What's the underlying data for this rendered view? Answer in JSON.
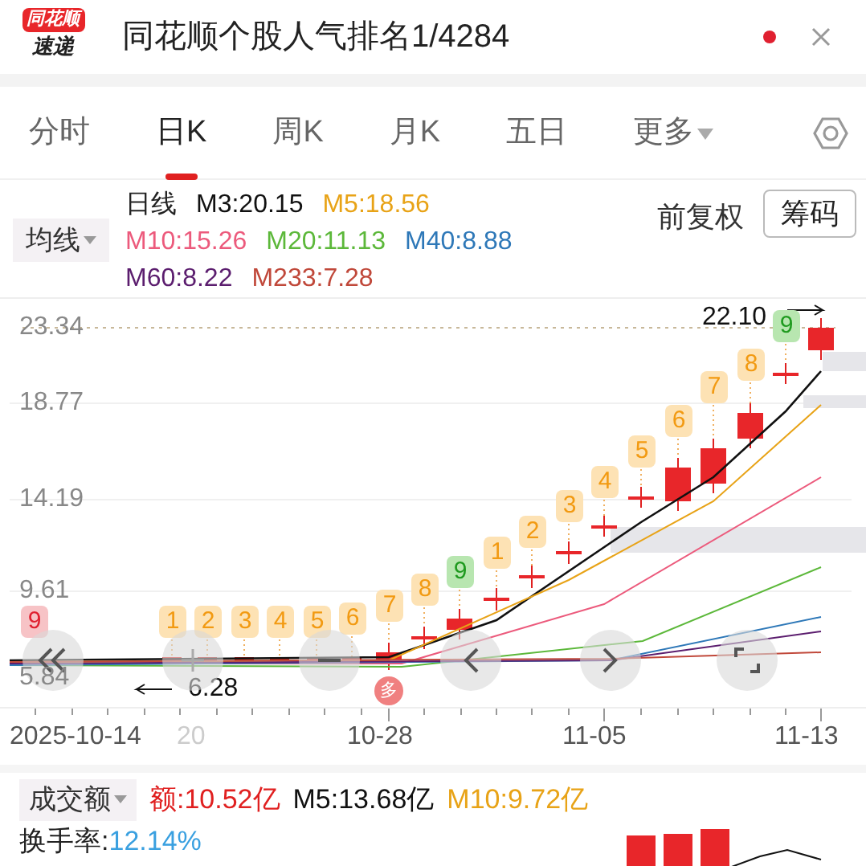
{
  "header": {
    "logo_top": "同花顺",
    "logo_bottom": "速递",
    "title": "同花顺个股人气排名1/4284"
  },
  "tabs": [
    {
      "label": "分时",
      "selected": false,
      "kind": "plain"
    },
    {
      "label": "日K",
      "selected": true,
      "kind": "plain"
    },
    {
      "label": "周K",
      "selected": false,
      "kind": "plain"
    },
    {
      "label": "月K",
      "selected": false,
      "kind": "plain"
    },
    {
      "label": "五日",
      "selected": false,
      "kind": "plain"
    },
    {
      "label": "更多",
      "selected": false,
      "kind": "dropdown"
    }
  ],
  "legend": {
    "selector": "均线",
    "rows": [
      [
        {
          "text": "日线",
          "color": "#222222"
        },
        {
          "text": "M3:20.15",
          "color": "#111111"
        },
        {
          "text": "M5:18.56",
          "color": "#e8a317"
        }
      ],
      [
        {
          "text": "M10:15.26",
          "color": "#ec5a7c"
        },
        {
          "text": "M20:11.13",
          "color": "#5cb83a"
        },
        {
          "text": "M40:8.88",
          "color": "#2e78b8"
        }
      ],
      [
        {
          "text": "M60:8.22",
          "color": "#5b1d6e"
        },
        {
          "text": "M233:7.28",
          "color": "#c0483a"
        }
      ]
    ],
    "adjust": "前复权",
    "chips_button": "筹码"
  },
  "chart": {
    "y_labels": [
      "23.34",
      "18.77",
      "14.19",
      "9.61",
      "5.84"
    ],
    "high_label": "22.10",
    "low_label": "6.28",
    "signal_marker": "多",
    "td_markers": [
      {
        "label": "9",
        "kind": "down"
      },
      {
        "label": "1",
        "kind": "count"
      },
      {
        "label": "2",
        "kind": "count"
      },
      {
        "label": "3",
        "kind": "count"
      },
      {
        "label": "4",
        "kind": "count"
      },
      {
        "label": "5",
        "kind": "count"
      },
      {
        "label": "6",
        "kind": "count"
      },
      {
        "label": "7",
        "kind": "count"
      },
      {
        "label": "8",
        "kind": "count"
      },
      {
        "label": "9",
        "kind": "up"
      },
      {
        "label": "1",
        "kind": "count"
      },
      {
        "label": "2",
        "kind": "count"
      },
      {
        "label": "3",
        "kind": "count"
      },
      {
        "label": "4",
        "kind": "count"
      },
      {
        "label": "5",
        "kind": "count"
      },
      {
        "label": "6",
        "kind": "count"
      },
      {
        "label": "7",
        "kind": "count"
      },
      {
        "label": "8",
        "kind": "count"
      },
      {
        "label": "9",
        "kind": "up"
      }
    ],
    "x_labels": [
      {
        "text": "2025-10-14",
        "kind": "main"
      },
      {
        "text": "20",
        "kind": "faded"
      },
      {
        "text": "10-28",
        "kind": "main"
      },
      {
        "text": "11-05",
        "kind": "main"
      },
      {
        "text": "11-13",
        "kind": "main"
      }
    ]
  },
  "volume": {
    "selector": "成交额",
    "values": [
      {
        "text": "额:10.52亿",
        "color": "#e02020"
      },
      {
        "text": "M5:13.68亿",
        "color": "#111111"
      },
      {
        "text": "M10:9.72亿",
        "color": "#e8a317"
      }
    ],
    "turnover_label": "换手率:",
    "turnover": "12.14%"
  }
}
